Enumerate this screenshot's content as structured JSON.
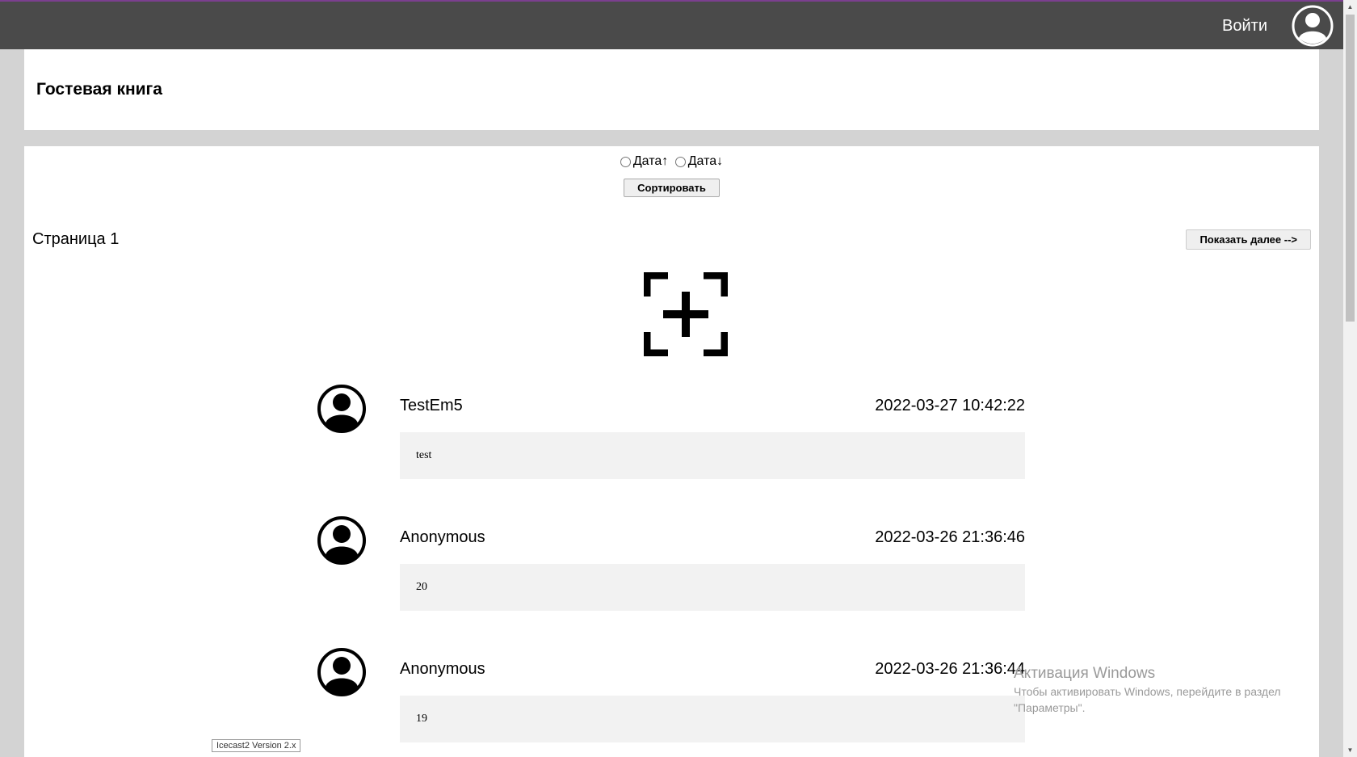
{
  "header": {
    "login_label": "Войти",
    "avatar_icon": "user-circle-icon"
  },
  "title_panel": {
    "title": "Гостевая книга"
  },
  "sort": {
    "options": [
      {
        "label": "Дата↑",
        "checked": false
      },
      {
        "label": "Дата↓",
        "checked": false
      }
    ],
    "button_label": "Сортировать"
  },
  "pagination": {
    "page_label": "Страница 1",
    "next_label": "Показать далее -->"
  },
  "add_entry": {
    "icon": "add-box-icon"
  },
  "entries": [
    {
      "author": "TestEm5",
      "date": "2022-03-27 10:42:22",
      "text": "test"
    },
    {
      "author": "Anonymous",
      "date": "2022-03-26 21:36:46",
      "text": "20"
    },
    {
      "author": "Anonymous",
      "date": "2022-03-26 21:36:44",
      "text": "19"
    }
  ],
  "watermark": {
    "title": "Активация Windows",
    "line1": "Чтобы активировать Windows, перейдите в раздел",
    "line2": "\"Параметры\"."
  },
  "status_tooltip": "Icecast2 Version 2.x",
  "colors": {
    "header_bg": "#4a4a4a",
    "header_accent": "#7b3f8f",
    "page_bg": "#d3d3d3",
    "entry_bg": "#f2f2f2"
  }
}
